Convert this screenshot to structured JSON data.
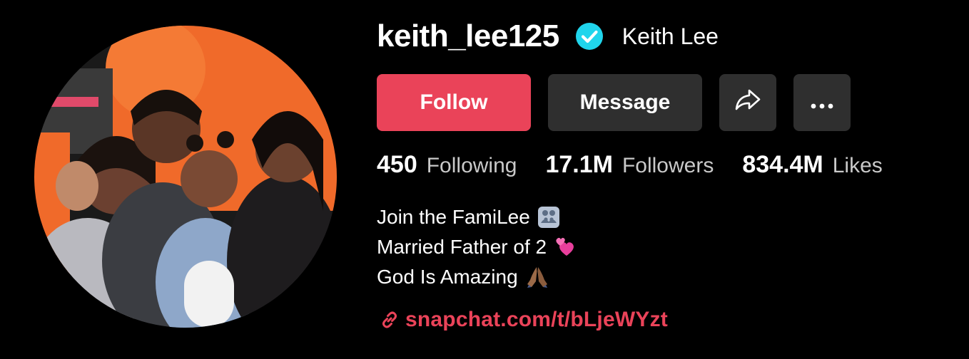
{
  "profile": {
    "username": "keith_lee125",
    "display_name": "Keith Lee",
    "verified": true,
    "verified_icon": "verified-check-icon",
    "avatar_icon": "profile-photo-family"
  },
  "actions": {
    "follow_label": "Follow",
    "message_label": "Message",
    "share_icon": "share-arrow-icon",
    "more_icon": "more-dots-icon"
  },
  "stats": [
    {
      "value": "450",
      "label": "Following"
    },
    {
      "value": "17.1M",
      "label": "Followers"
    },
    {
      "value": "834.4M",
      "label": "Likes"
    }
  ],
  "bio": {
    "lines": [
      {
        "text": "Join the FamiLee",
        "emoji": "family-emoji"
      },
      {
        "text": "Married Father of 2",
        "emoji": "two-hearts-emoji"
      },
      {
        "text": "God Is Amazing",
        "emoji": "praying-hands-emoji"
      }
    ]
  },
  "link": {
    "icon": "link-icon",
    "text": "snapchat.com/t/bLjeWYzt"
  },
  "colors": {
    "background": "#000000",
    "accent": "#ea4359",
    "button_dark": "#2f2f2f",
    "verified_badge": "#20d5ec",
    "secondary_text": "#c9c9c9"
  }
}
